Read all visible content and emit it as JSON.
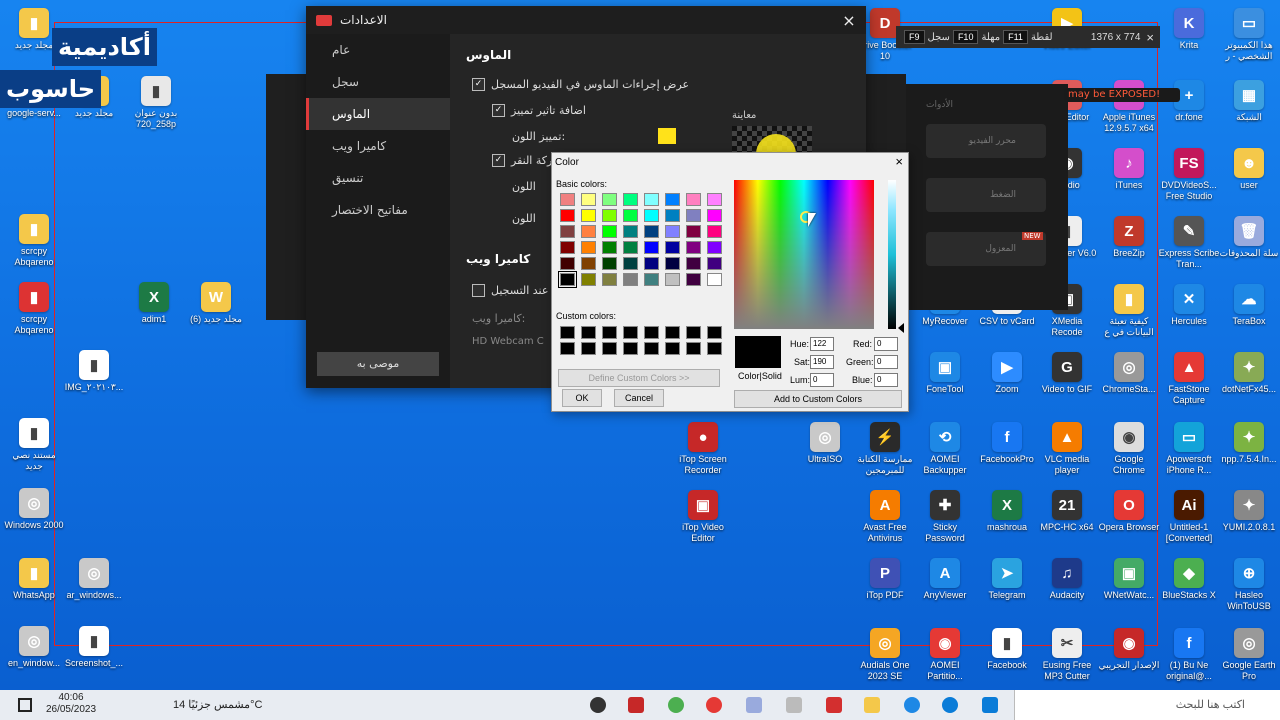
{
  "brand": {
    "line1": "أكاديمية",
    "line2": "حاسوب"
  },
  "rec_toolbar": {
    "close": "×",
    "size": "1376 x 774",
    "items": [
      {
        "label": "لقطة",
        "key": "F11"
      },
      {
        "label": "مهلة",
        "key": "F10"
      },
      {
        "label": "سجل",
        "key": "F9"
      }
    ]
  },
  "warning": "may be EXPOSED!",
  "bg_app": {
    "tiles": [
      "محرر الفيديو",
      "الضغط",
      "المعزول"
    ],
    "badge": "NEW",
    "header": "الأدوات"
  },
  "settings": {
    "title": "الاعدادات",
    "close": "×",
    "sidebar": [
      "عام",
      "سجل",
      "الماوس",
      "كاميرا ويب",
      "تنسيق",
      "مفاتيح الاختصار"
    ],
    "record_button": "موصى به",
    "section_mouse": "الماوس",
    "opt1": "عرض إجراءات الماوس في الفيديو المسجل",
    "opt2": "اضافة تاثير تمييز",
    "opt3": "تمييز اللون:",
    "opt4": "حركة النقر",
    "opt5": "اللون",
    "opt6": "اللون",
    "preview": "معاينة",
    "section_webcam": "كاميرا ويب",
    "opt7": "عند التسجيل",
    "opt8": "كاميرا ويب:",
    "webcam_value": "HD Webcam C"
  },
  "color_dialog": {
    "title": "Color",
    "close": "×",
    "basic_label": "Basic colors:",
    "custom_label": "Custom colors:",
    "define_btn": "Define Custom Colors >>",
    "ok": "OK",
    "cancel": "Cancel",
    "color_solid": "Color|Solid",
    "hue_label": "Hue:",
    "hue": "122",
    "sat_label": "Sat:",
    "sat": "190",
    "lum_label": "Lum:",
    "lum": "0",
    "red_label": "Red:",
    "red": "0",
    "green_label": "Green:",
    "green": "0",
    "blue_label": "Blue:",
    "blue": "0",
    "add_btn": "Add to Custom Colors",
    "basic_colors": [
      "#f08080",
      "#ffff80",
      "#80ff80",
      "#00ff80",
      "#80ffff",
      "#0080ff",
      "#ff80c0",
      "#ff80ff",
      "#ff0000",
      "#ffff00",
      "#80ff00",
      "#00ff40",
      "#00ffff",
      "#0080c0",
      "#8080c0",
      "#ff00ff",
      "#804040",
      "#ff8040",
      "#00ff00",
      "#008080",
      "#004080",
      "#8080ff",
      "#800040",
      "#ff0080",
      "#800000",
      "#ff8000",
      "#008000",
      "#008040",
      "#0000ff",
      "#0000a0",
      "#800080",
      "#8000ff",
      "#400000",
      "#804000",
      "#004000",
      "#004040",
      "#000080",
      "#000040",
      "#400040",
      "#400080",
      "#000000",
      "#808000",
      "#808040",
      "#808080",
      "#408080",
      "#c0c0c0",
      "#400040",
      "#ffffff"
    ]
  },
  "desktop_left": [
    {
      "label": "مجلد جديد",
      "color": "#f4c84a",
      "glyph": "▮"
    },
    {
      "label": "google-serv...",
      "color": "#e8e8e8",
      "glyph": "▮"
    },
    {
      "label": "مجلد جديد",
      "color": "#f4c84a",
      "glyph": "▮"
    },
    {
      "label": "بدون عنوان 258_720p",
      "color": "#e8e8e8",
      "glyph": "▮"
    },
    {
      "label": "scrcpy Abqareno",
      "color": "#f4c84a",
      "glyph": "▮"
    },
    {
      "label": "scrcpy Abqareno",
      "color": "#d33",
      "glyph": "▮"
    },
    {
      "label": "adim1",
      "color": "#1d7a45",
      "glyph": "X"
    },
    {
      "label": "مجلد جديد (6)",
      "color": "#f4c84a",
      "glyph": "W"
    },
    {
      "label": "IMG_٢٠٢١٠٣...",
      "color": "#fff",
      "glyph": "▮"
    },
    {
      "label": "مستند نصي جديد",
      "color": "#fff",
      "glyph": "▮"
    },
    {
      "label": "Windows 2000",
      "color": "#c9c9c9",
      "glyph": "◎"
    },
    {
      "label": "WhatsApp",
      "color": "#f4c84a",
      "glyph": "▮"
    },
    {
      "label": "ar_windows...",
      "color": "#c9c9c9",
      "glyph": "◎"
    },
    {
      "label": "en_window...",
      "color": "#c9c9c9",
      "glyph": "◎"
    },
    {
      "label": "Screenshot_...",
      "color": "#fff",
      "glyph": "▮"
    }
  ],
  "desktop_right": [
    {
      "label": "Drive Booster 10",
      "color": "#c0392b",
      "glyph": "D"
    },
    {
      "label": "Video Editor",
      "color": "#f3c316",
      "glyph": "▶"
    },
    {
      "label": "Krita",
      "color": "#4a6bdc",
      "glyph": "K"
    },
    {
      "label": "هذا الكمبيوتر الشخصي - ر",
      "color": "#3b8fe0",
      "glyph": "▭"
    },
    {
      "label": "Shot Editor",
      "color": "#e05b5b",
      "glyph": "S"
    },
    {
      "label": "Apple iTunes 12.9.5.7 x64",
      "color": "#d44ecb",
      "glyph": "♪"
    },
    {
      "label": "dr.fone",
      "color": "#1e88e5",
      "glyph": "+"
    },
    {
      "label": "الشبكة",
      "color": "#3ca0e0",
      "glyph": "▦"
    },
    {
      "label": "Studio",
      "color": "#333",
      "glyph": "◉"
    },
    {
      "label": "iTunes",
      "color": "#d44ecb",
      "glyph": "♪"
    },
    {
      "label": "DVDVideoS... Free Studio",
      "color": "#c2185b",
      "glyph": "FS"
    },
    {
      "label": "user",
      "color": "#f4c84a",
      "glyph": "☻"
    },
    {
      "label": "atsapp er V6.0",
      "color": "#eee",
      "glyph": "▮"
    },
    {
      "label": "BreeZip",
      "color": "#c0392b",
      "glyph": "Z"
    },
    {
      "label": "Express Scribe Tran...",
      "color": "#555",
      "glyph": "✎"
    },
    {
      "label": "سلة المحذوفات",
      "color": "#9ad",
      "glyph": "🗑"
    },
    {
      "label": "MyRecover",
      "color": "#1e88e5",
      "glyph": "↺"
    },
    {
      "label": "CSV to vCard",
      "color": "#eee",
      "glyph": "▮"
    },
    {
      "label": "XMedia Recode",
      "color": "#333",
      "glyph": "▣"
    },
    {
      "label": "كيفية تعبئة البيانات في ع",
      "color": "#f4c84a",
      "glyph": "▮"
    },
    {
      "label": "Hercules",
      "color": "#1e88e5",
      "glyph": "✕"
    },
    {
      "label": "TeraBox",
      "color": "#1e88e5",
      "glyph": "☁"
    },
    {
      "label": "FoneTool",
      "color": "#1e88e5",
      "glyph": "▣"
    },
    {
      "label": "Zoom",
      "color": "#2d8cff",
      "glyph": "▶"
    },
    {
      "label": "Video to GIF",
      "color": "#333",
      "glyph": "G"
    },
    {
      "label": "ChromeSta...",
      "color": "#999",
      "glyph": "◎"
    },
    {
      "label": "FastStone Capture",
      "color": "#e53935",
      "glyph": "▲"
    },
    {
      "label": "dotNetFx45...",
      "color": "#8a5",
      "glyph": "✦"
    },
    {
      "label": "iTop Screen Recorder",
      "color": "#c62828",
      "glyph": "●"
    },
    {
      "label": "UltraISO",
      "color": "#c9c9c9",
      "glyph": "◎"
    },
    {
      "label": "ممارسة الكتابة للمبرمجين",
      "color": "#2a2a2a",
      "glyph": "⚡"
    },
    {
      "label": "AOMEI Backupper",
      "color": "#1e88e5",
      "glyph": "⟲"
    },
    {
      "label": "FacebookPro",
      "color": "#1877f2",
      "glyph": "f"
    },
    {
      "label": "VLC media player",
      "color": "#f57c00",
      "glyph": "▲"
    },
    {
      "label": "Google Chrome",
      "color": "#ddd",
      "glyph": "◉"
    },
    {
      "label": "Apowersoft iPhone R...",
      "color": "#13a3d9",
      "glyph": "▭"
    },
    {
      "label": "npp.7.5.4.In...",
      "color": "#7cb342",
      "glyph": "✦"
    },
    {
      "label": "iTop Video Editor",
      "color": "#c62828",
      "glyph": "▣"
    },
    {
      "label": "Avast Free Antivirus",
      "color": "#f57c00",
      "glyph": "A"
    },
    {
      "label": "Sticky Password",
      "color": "#333",
      "glyph": "✚"
    },
    {
      "label": "mashroua",
      "color": "#1d7a45",
      "glyph": "X"
    },
    {
      "label": "MPC-HC x64",
      "color": "#333",
      "glyph": "21"
    },
    {
      "label": "Opera Browser",
      "color": "#e53935",
      "glyph": "O"
    },
    {
      "label": "Untitled-1 [Converted]",
      "color": "#4a1a00",
      "glyph": "Ai"
    },
    {
      "label": "YUMI.2.0.8.1",
      "color": "#888",
      "glyph": "✦"
    },
    {
      "label": "iTop PDF",
      "color": "#3f51b5",
      "glyph": "P"
    },
    {
      "label": "AnyViewer",
      "color": "#1e88e5",
      "glyph": "A"
    },
    {
      "label": "Telegram",
      "color": "#2aa3e0",
      "glyph": "➤"
    },
    {
      "label": "Audacity",
      "color": "#1e3a8a",
      "glyph": "♫"
    },
    {
      "label": "WNetWatc...",
      "color": "#4a6",
      "glyph": "▣"
    },
    {
      "label": "BlueStacks X",
      "color": "#4caf50",
      "glyph": "◆"
    },
    {
      "label": "Hasleo WinToUSB",
      "color": "#1e88e5",
      "glyph": "⊕"
    },
    {
      "label": "Audials One 2023 SE",
      "color": "#f5a623",
      "glyph": "◎"
    },
    {
      "label": "AOMEI Partitio...",
      "color": "#e53935",
      "glyph": "◉"
    },
    {
      "label": "Facebook",
      "color": "#fff",
      "glyph": "▮"
    },
    {
      "label": "Eusing Free MP3 Cutter",
      "color": "#eee",
      "glyph": "✂"
    },
    {
      "label": "الإصدار التجريبي",
      "color": "#c62828",
      "glyph": "◉"
    },
    {
      "label": "(1) Bu Ne original@...",
      "color": "#1877f2",
      "glyph": "f"
    },
    {
      "label": "Google Earth Pro",
      "color": "#999",
      "glyph": "◎"
    }
  ],
  "taskbar": {
    "time": "40:06",
    "date": "26/05/2023",
    "weather": "مشمس جزئيًا 14°C",
    "search": "اكتب هنا للبحث"
  }
}
